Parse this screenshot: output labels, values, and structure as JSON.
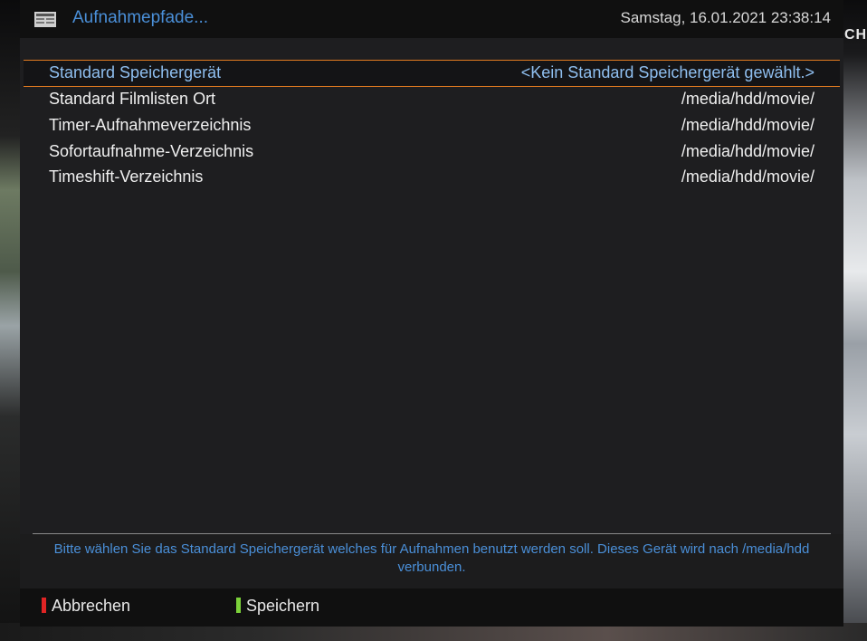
{
  "header": {
    "title": "Aufnahmepfade...",
    "datetime": "Samstag, 16.01.2021  23:38:14",
    "icon": "settings-screen-icon"
  },
  "settings": [
    {
      "label": "Standard Speichergerät",
      "value": "<Kein Standard Speichergerät gewählt.>",
      "selected": true
    },
    {
      "label": "Standard Filmlisten Ort",
      "value": "/media/hdd/movie/",
      "selected": false
    },
    {
      "label": "Timer-Aufnahmeverzeichnis",
      "value": "/media/hdd/movie/",
      "selected": false
    },
    {
      "label": "Sofortaufnahme-Verzeichnis",
      "value": "/media/hdd/movie/",
      "selected": false
    },
    {
      "label": "Timeshift-Verzeichnis",
      "value": "/media/hdd/movie/",
      "selected": false
    }
  ],
  "help_text": "Bitte wählen Sie das Standard Speichergerät welches für Aufnahmen benutzt werden soll. Dieses Gerät wird nach /media/hdd verbunden.",
  "footer": {
    "red_label": "Abbrechen",
    "green_label": "Speichern"
  },
  "background": {
    "corner_text": "CHA"
  },
  "colors": {
    "accent_blue": "#4a8fd8",
    "selection_border": "#e07a20",
    "red_key": "#e02424",
    "green_key": "#7cd23a"
  }
}
